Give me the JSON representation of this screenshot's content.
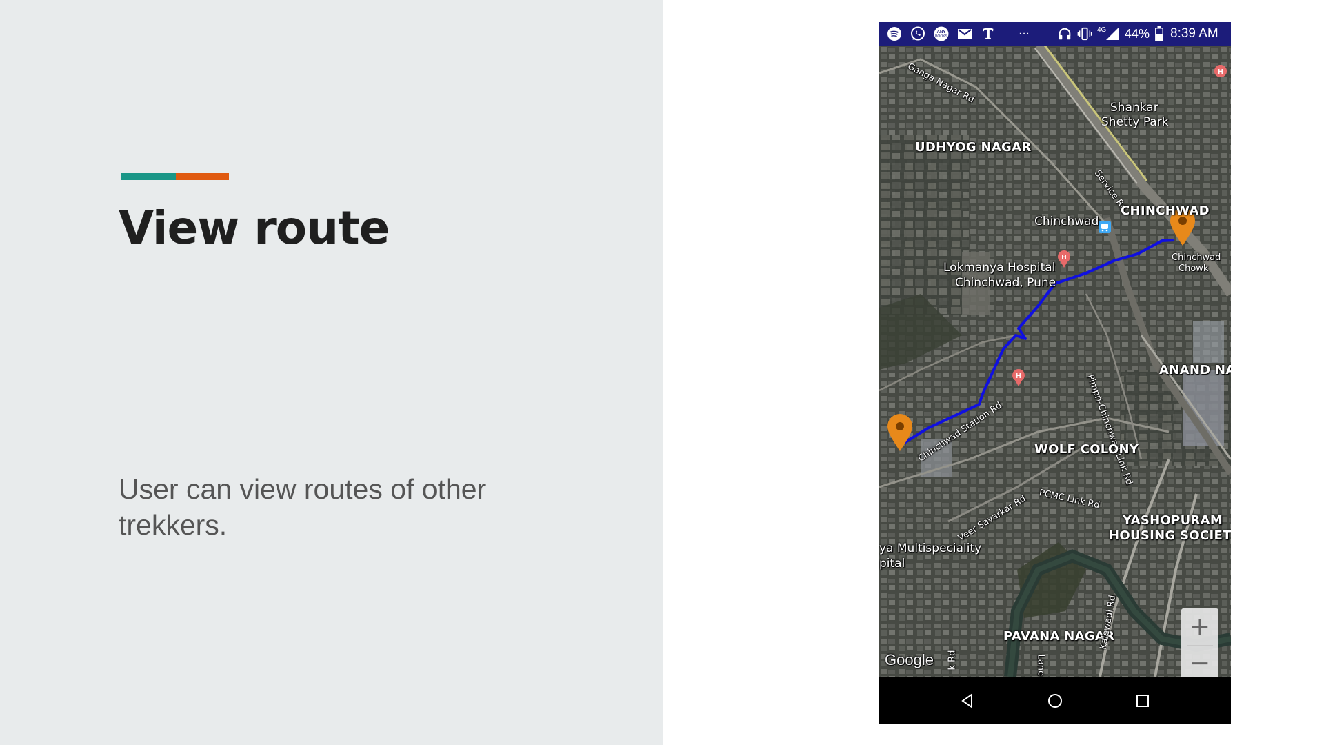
{
  "slide": {
    "title": "View route",
    "body": "User can view routes of other trekkers.",
    "accent_colors": [
      "#1a9687",
      "#e05a10"
    ]
  },
  "status_bar": {
    "notification_icons": [
      "spotify-icon",
      "whatsapp-icon",
      "anybooks-icon",
      "gmail-icon",
      "nytimes-icon"
    ],
    "more": "···",
    "network": "4G",
    "battery": "44%",
    "time": "8:39 AM"
  },
  "map": {
    "labels": {
      "ganga_nagar_rd": "Ganga Nagar Rd",
      "shankar_shetty_park_1": "Shankar",
      "shankar_shetty_park_2": "Shetty Park",
      "udhyog_nagar": "UDHYOG NAGAR",
      "service_rd": "Service Rd",
      "chinchwad_area": "CHINCHWAD",
      "chinchwad_station": "Chinchwad",
      "chinchwad_chowk_1": "Chinchwad",
      "chinchwad_chowk_2": "Chowk",
      "lokmanya_1": "Lokmanya Hospital",
      "lokmanya_2": "Chinchwad, Pune",
      "anand_nagar": "ANAND NAG",
      "pimpri_chinchwad_link_rd": "Pimpri-Chinchwad Link Rd",
      "chinchwad_station_rd": "Chinchwad Station Rd",
      "wolf_colony": "WOLF COLONY",
      "pcmc_link_rd": "PCMC Link Rd",
      "veer_savarkar_rd": "Veer Savarkar Rd",
      "yashopuram_1": "YASHOPURAM",
      "yashopuram_2": "HOUSING SOCIETY",
      "multispeciality_1": "ya Multispeciality",
      "multispeciality_2": "pital",
      "pavana_nagar": "PAVANA NAGAR",
      "google": "Google",
      "lane": "Lane N",
      "kalewadi_rd": "Kalewadi Rd",
      "k_rd": "k Rd"
    },
    "route_color": "#1010e0",
    "marker_color": "#e8891a",
    "zoom": {
      "in": "+",
      "out": "−"
    }
  },
  "nav_bar": {
    "back": "back-icon",
    "home": "home-icon",
    "recents": "recents-icon"
  }
}
